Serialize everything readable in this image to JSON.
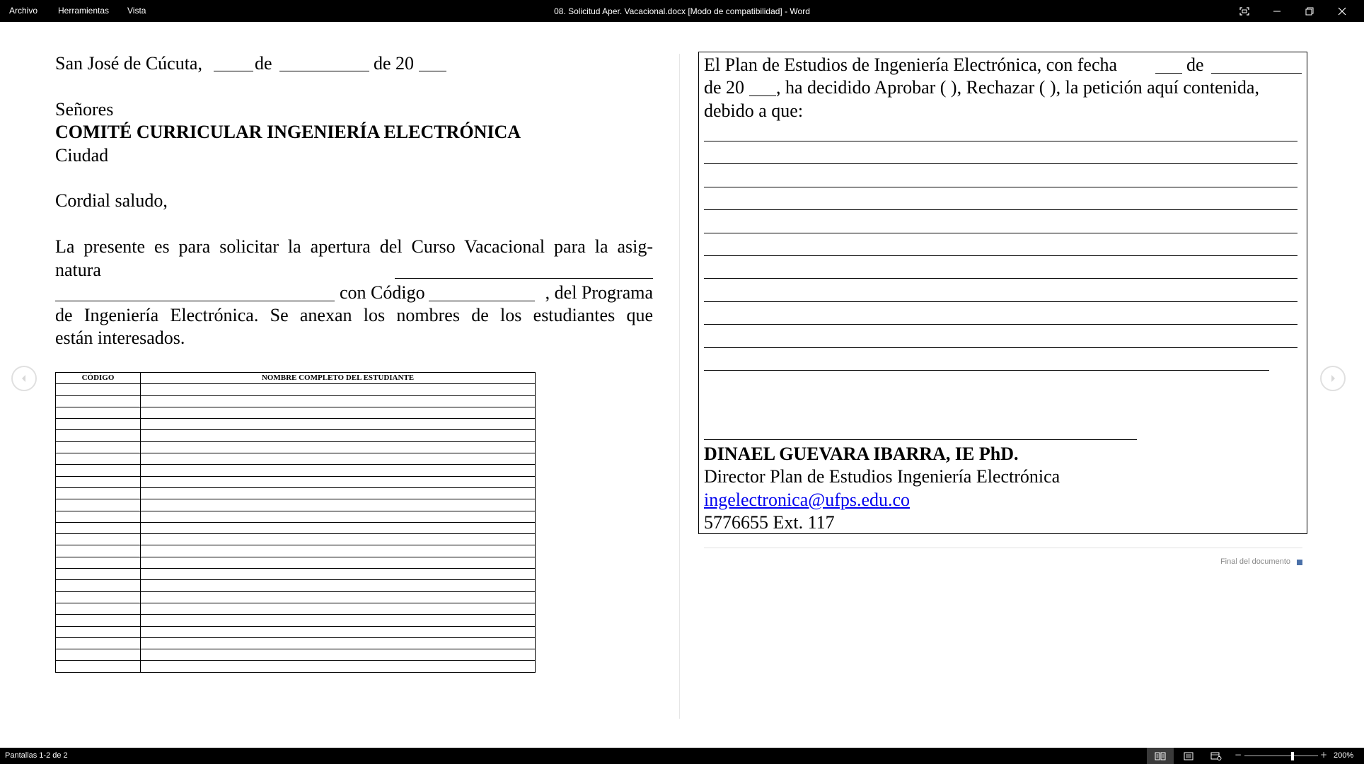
{
  "menu": [
    "Archivo",
    "Herramientas",
    "Vista"
  ],
  "window_title": "08. Solicitud Aper. Vacacional.docx [Modo de compatibilidad]  -  Word",
  "status": {
    "screens": "Pantallas 1-2 de 2",
    "zoom": "200%",
    "zoom_fraction": 0.65
  },
  "left_page": {
    "date_line": {
      "city": "San José de Cúcuta,",
      "de1": "de",
      "de2": "de 20"
    },
    "greeting_to": "Señores",
    "committee": "COMITÉ CURRICULAR  INGENIERÍA ELECTRÓNICA",
    "city": "Ciudad",
    "salutation": "Cordial saludo,",
    "body_line1": "La presente es para solicitar la apertura del Curso Vacacional para la asig-",
    "body_line2": "natura",
    "body_line3_code": "con Código",
    "body_line3_program": ", del Programa",
    "body_line4": "de Ingeniería Electrónica.  Se anexan los nombres de los estudiantes que",
    "body_line5": "están interesados.",
    "table_headers": [
      "CÓDIGO",
      "NOMBRE COMPLETO DEL ESTUDIANTE"
    ],
    "table_empty_rows": 25
  },
  "right_page": {
    "line1_a": "El Plan de Estudios de Ingeniería Electrónica, con fecha",
    "line1_b": "de",
    "line2_a": "de 20",
    "line2_b": ", ha decidido Aprobar (  ), Rechazar (  ), la petición aquí contenida,",
    "line3": "debido a que:",
    "signer_name": "DINAEL GUEVARA IBARRA, IE PhD.",
    "signer_title": "Director Plan de Estudios Ingeniería Electrónica",
    "email": "ingelectronica@ufps.edu.co",
    "phone": "5776655 Ext. 117",
    "end_label": "Final del documento"
  },
  "colors": {
    "titlebar": "#000000",
    "link": "#0000ee",
    "end_marker": "#4a70a8"
  }
}
